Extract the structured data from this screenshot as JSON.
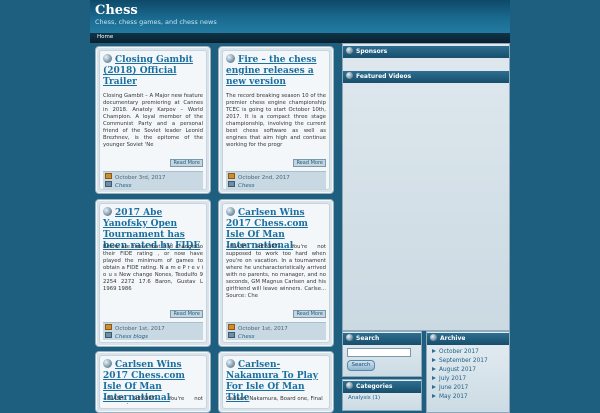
{
  "site": {
    "title": "Chess",
    "description": "Chess, chess games, and chess news"
  },
  "nav": {
    "home": "Home"
  },
  "posts": [
    {
      "title": "Closing Gambit (2018) Official Trailer",
      "excerpt": "Closing Gambit – A Major new feature documentary premiering at Cannes in 2018. Anatoly Karpov – World Champion. A loyal member of the Communist Party and a personal friend of the Soviet leader Leonid Brezhnev, is the epitome of the younger Soviet 'Ne",
      "readmore": "Read More",
      "date": "October 3rd, 2017",
      "category": "Chess"
    },
    {
      "title": "Fire – the chess engine releases a new version",
      "excerpt": "The record breaking season 10 of the premier chess engine championship TCEC is going to start October 10th, 2017. It is a compact three stage championship, involving the current best chess software as well as engines that aim high and continue working for the progr",
      "readmore": "Read More",
      "date": "October 2nd, 2017",
      "category": "Chess"
    },
    {
      "title": "2017 Abe Yanofsky Open Tournament has been rated by FIDE",
      "excerpt": "Below are those that had changesto their FIDE rating , or now have played the minimum of games to obtain a FIDE rating. N a m e P r e v i o u s New change Nones, Teodulfo 9 2254 2272 17.6 Baron, Gustav L 1969 1986",
      "readmore": "Read More",
      "date": "October 1st, 2017",
      "category": "Chess blogs"
    },
    {
      "title": "Carlsen Wins 2017 Chess.com Isle Of Man International",
      "excerpt": "--FLASH REPORT-- You're not supposed to work too hard when you're on vacation. In a tournament where he uncharacteristically arrived with no parents, no manager, and no seconds, GM Magnus Carlsen and his girlfriend will leave winners. Carlse... Source: Che",
      "readmore": "Read More",
      "date": "October 1st, 2017",
      "category": "Chess"
    },
    {
      "title": "Carlsen Wins 2017 Chess.com Isle Of Man International",
      "excerpt": "--FLASH REPORT-- You're not supposed",
      "readmore": "",
      "date": "",
      "category": ""
    },
    {
      "title": "Carlsen-Nakamura To Play For Isle Of Man Title",
      "excerpt": "Carlsen, Nakamura, Board one, Final",
      "readmore": "",
      "date": "",
      "category": ""
    }
  ],
  "sidebar": {
    "sponsors": "Sponsors",
    "featured": "Featured Videos",
    "search": {
      "title": "Search",
      "button": "Search",
      "placeholder": ""
    },
    "archive": {
      "title": "Archive",
      "items": [
        "October 2017",
        "September 2017",
        "August 2017",
        "July 2017",
        "June 2017",
        "May 2017"
      ]
    },
    "categories": {
      "title": "Categories",
      "items": [
        "Analysis (1)"
      ]
    }
  }
}
